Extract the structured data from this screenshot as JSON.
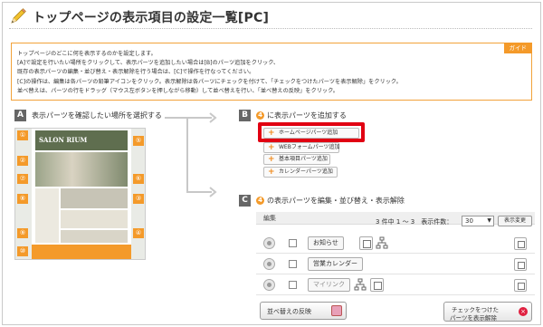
{
  "page": {
    "title": "トップページの表示項目の設定一覧[PC]"
  },
  "guide": {
    "badge": "ガイド",
    "lines": [
      "トップページのどこに何を表示するのかを設定します。",
      "[A]で設定を行いたい場所をクリックして、表示パーツを追加したい場合は[B]のパーツ追加をクリック、",
      "既存の表示パーツの編集・並び替え・表示解除を行う場合は、[C]で操作を行なってください。",
      "[C]の操作は、編集は各パーツの鉛筆アイコンをクリック。表示解除は各パーツにチェックを付けて、「チェックをつけたパーツを表示解除」をクリック。",
      "並べ替えは、パーツの行をドラッグ（マウス左ボタンを押しながら移動）して並べ替えを行い、「並べ替えの反映」をクリック。"
    ]
  },
  "section_a": {
    "letter": "A",
    "text": "表示パーツを確認したい場所を選択する",
    "thumb_brand": "SALON RIUM",
    "thumb_tabs": [
      "①",
      "②",
      "③",
      "④",
      "⑤",
      "⑥",
      "⑦",
      "⑧",
      "⑨",
      "⑩"
    ]
  },
  "section_b": {
    "letter": "B",
    "num": "4",
    "text": "に表示パーツを追加する",
    "buttons": [
      "ホームページパーツ追加",
      "WEBフォームパーツ追加",
      "基本項目パーツ追加",
      "カレンダーパーツ追加"
    ]
  },
  "section_c": {
    "letter": "C",
    "num": "4",
    "text": "の表示パーツを編集・並び替え・表示解除",
    "header_label": "編集",
    "pager_text": "3 件中 1 ～ 3　表示件数：",
    "per_page": "30",
    "change_button": "表示変更",
    "rows": [
      {
        "label": "お知らせ"
      },
      {
        "label": "営業カレンダー"
      },
      {
        "label": "マイリンク"
      }
    ],
    "reorder_button": "並べ替えの反映",
    "hide_button_line1": "チェックをつけた",
    "hide_button_line2": "パーツを表示解除"
  },
  "colors": {
    "accent": "#f49a2a",
    "highlight": "#e10012",
    "section_letter_bg": "#666666"
  }
}
